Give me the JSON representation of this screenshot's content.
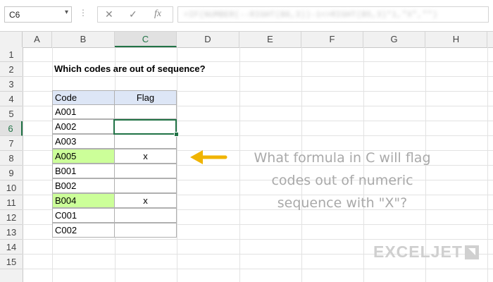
{
  "formula_bar": {
    "name_box": "C6",
    "name_box_arrow": "▾",
    "dots": "⋮",
    "cancel_icon": "✕",
    "enter_icon": "✓",
    "fx_label": "fx",
    "formula_text": "=IF(NUMBER(--RIGHT(B6,3))-1<>RIGHT(B5,3)*1,\"X\",\"\")"
  },
  "columns": [
    "A",
    "B",
    "C",
    "D",
    "E",
    "F",
    "G",
    "H"
  ],
  "active_column": "C",
  "rows": [
    "1",
    "2",
    "3",
    "4",
    "5",
    "6",
    "7",
    "8",
    "9",
    "10",
    "11",
    "12",
    "13",
    "14",
    "15"
  ],
  "active_row": "6",
  "sheet": {
    "title": "Which codes are out of sequence?",
    "table_header": {
      "code": "Code",
      "flag": "Flag"
    },
    "table_rows": [
      {
        "code": "A001",
        "flag": "",
        "highlight": false
      },
      {
        "code": "A002",
        "flag": "",
        "highlight": false
      },
      {
        "code": "A003",
        "flag": "",
        "highlight": false
      },
      {
        "code": "A005",
        "flag": "x",
        "highlight": true
      },
      {
        "code": "B001",
        "flag": "",
        "highlight": false
      },
      {
        "code": "B002",
        "flag": "",
        "highlight": false
      },
      {
        "code": "B004",
        "flag": "x",
        "highlight": true
      },
      {
        "code": "C001",
        "flag": "",
        "highlight": false
      },
      {
        "code": "C002",
        "flag": "",
        "highlight": false
      }
    ]
  },
  "annotation": {
    "line1": "What formula in C will flag",
    "line2": "codes out of numeric",
    "line3": "sequence with \"X\"?"
  },
  "logo": {
    "text": "EXCELJET",
    "mark_icon": "exceljet-logo-icon"
  },
  "colors": {
    "accent": "#217346",
    "header_fill": "#dde6f6",
    "highlight_fill": "#ccff99",
    "arrow": "#f0b400"
  }
}
